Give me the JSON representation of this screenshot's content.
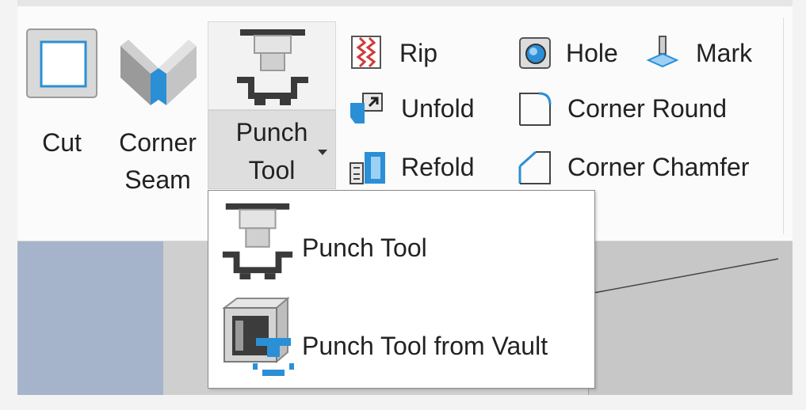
{
  "ribbon": {
    "cut": {
      "label": "Cut",
      "icon": "cut-icon"
    },
    "corner_seam": {
      "line1": "Corner",
      "line2": "Seam",
      "icon": "corner-seam-icon"
    },
    "punch_tool": {
      "line1": "Punch",
      "line2": "Tool",
      "icon": "punch-tool-icon"
    },
    "rip": {
      "label": "Rip",
      "icon": "rip-icon"
    },
    "unfold": {
      "label": "Unfold",
      "icon": "unfold-icon"
    },
    "refold": {
      "label": "Refold",
      "icon": "refold-icon"
    },
    "hole": {
      "label": "Hole",
      "icon": "hole-icon"
    },
    "mark": {
      "label": "Mark",
      "icon": "mark-icon"
    },
    "corner_round": {
      "label": "Corner Round",
      "icon": "corner-round-icon"
    },
    "corner_chamfer": {
      "label": "Corner Chamfer",
      "icon": "corner-chamfer-icon"
    }
  },
  "dropdown": {
    "items": [
      {
        "label": "Punch Tool",
        "icon": "punch-tool-icon"
      },
      {
        "label": "Punch Tool from Vault",
        "icon": "punch-tool-vault-icon"
      }
    ]
  },
  "colors": {
    "accent_blue": "#2b8fd6",
    "icon_dark": "#3a3a3a",
    "rip_red": "#d23a3a"
  }
}
